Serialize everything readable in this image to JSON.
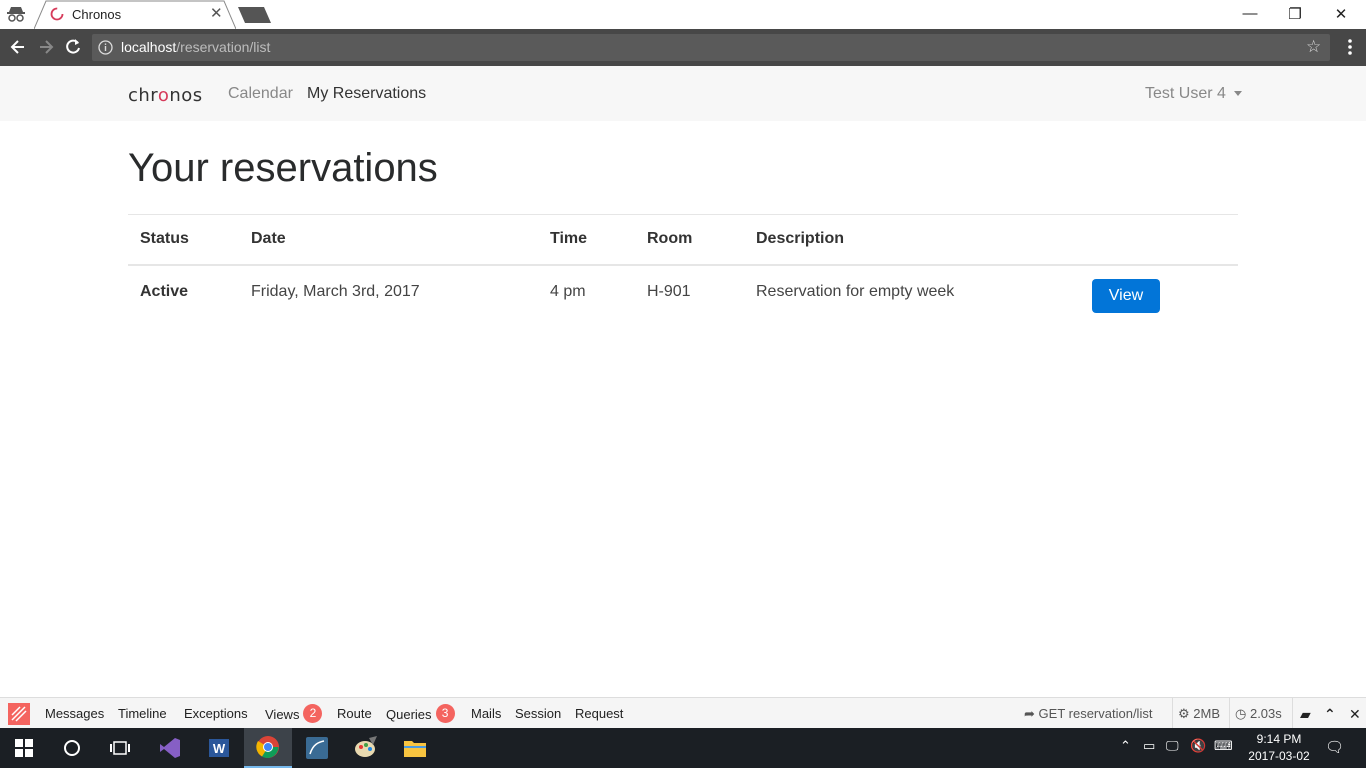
{
  "browser": {
    "tab_title": "Chronos",
    "url_host": "localhost",
    "url_path": "/reservation/list"
  },
  "navbar": {
    "brand_pre": "chr",
    "brand_o": "o",
    "brand_post": "nos",
    "links": [
      "Calendar",
      "My Reservations"
    ],
    "active_link": "My Reservations",
    "user": "Test User 4"
  },
  "main": {
    "title": "Your reservations",
    "table": {
      "headers": [
        "Status",
        "Date",
        "Time",
        "Room",
        "Description"
      ],
      "rows": [
        {
          "status": "Active",
          "date": "Friday, March 3rd, 2017",
          "time": "4 pm",
          "room": "H-901",
          "description": "Reservation for empty week",
          "action": "View"
        }
      ]
    }
  },
  "debugbar": {
    "items": [
      "Messages",
      "Timeline",
      "Exceptions",
      "Views",
      "Route",
      "Queries",
      "Mails",
      "Session",
      "Request"
    ],
    "views_count": "2",
    "queries_count": "3",
    "route": "GET reservation/list",
    "memory": "2MB",
    "time": "2.03s"
  },
  "taskbar": {
    "time": "9:14 PM",
    "date": "2017-03-02"
  },
  "colors": {
    "primary": "#0275d8",
    "brand_accent": "#d63a5a",
    "debug_accent": "#f4645f"
  }
}
